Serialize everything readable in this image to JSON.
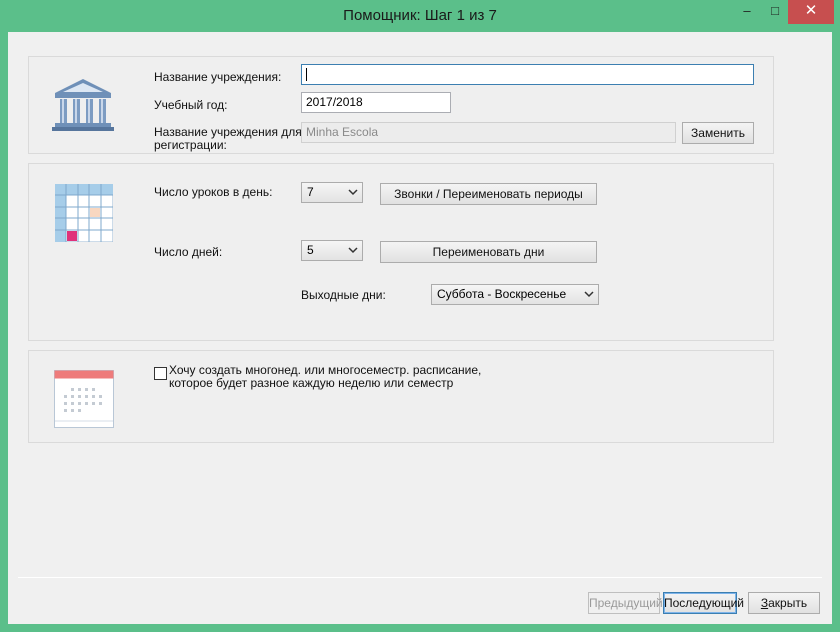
{
  "window": {
    "title": "Помощник: Шаг 1 из 7",
    "minimize_glyph": "–",
    "maximize_glyph": "□",
    "close_glyph": "✕"
  },
  "institution": {
    "name_label": "Название учреждения:",
    "name_value": "",
    "year_label": "Учебный год:",
    "year_value": "2017/2018",
    "reg_label_line1": "Название учреждения для",
    "reg_label_line2": "регистрации:",
    "reg_value": "Minha Escola",
    "replace_button": "Заменить",
    "icon": "institution-building-icon"
  },
  "schedule": {
    "lessons_label": "Число уроков в день:",
    "lessons_value": "7",
    "bells_button": "Звонки / Переименовать периоды",
    "days_label": "Число дней:",
    "days_value": "5",
    "rename_days_button": "Переименовать дни",
    "weekend_label": "Выходные дни:",
    "weekend_value": "Суббота - Воскресенье",
    "icon": "timetable-grid-icon"
  },
  "multiweek": {
    "checkbox_checked": false,
    "text_line1": "Хочу создать многонед. или многосеместр. расписание,",
    "text_line2": "которое будет разное каждую неделю или семестр",
    "icon": "calendar-icon"
  },
  "footer": {
    "prev_button": "Предыдущий",
    "next_button": "Последующий",
    "close_button_u": "З",
    "close_button_rest": "акрыть"
  },
  "colors": {
    "window_frame": "#5bbf8a",
    "close_button": "#c74f4f",
    "focus_border": "#3c7fb1",
    "grid_header": "#a6cde9",
    "grid_highlight": "#e0317a",
    "grid_peach": "#f8d7c0",
    "calendar_header": "#ee7b7b"
  }
}
